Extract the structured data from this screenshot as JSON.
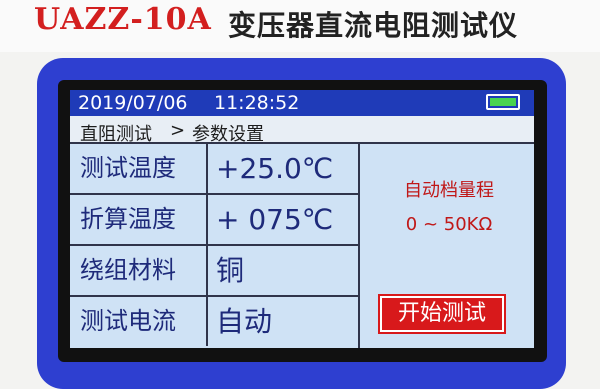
{
  "header": {
    "model": "UAZZ-10A",
    "product_name": "变压器直流电阻测试仪"
  },
  "status": {
    "date": "2019/07/06",
    "time": "11:28:52",
    "battery_icon": "battery-icon"
  },
  "breadcrumb": {
    "parent": "直阻测试",
    "separator": ">",
    "current": "参数设置"
  },
  "params": [
    {
      "label": "测试温度",
      "value": "+25.0℃"
    },
    {
      "label": "折算温度",
      "value": "+ 075℃"
    },
    {
      "label": "绕组材料",
      "value": "铜"
    },
    {
      "label": "测试电流",
      "value": "自动"
    }
  ],
  "range": {
    "title": "自动档量程",
    "value": "0 ~ 50KΩ"
  },
  "start_button": {
    "label": "开始测试"
  },
  "colors": {
    "bezel": "#2e3fd0",
    "statusbar": "#1f3bb8",
    "screen_bg": "#cfe2f5",
    "accent_red": "#d8191b",
    "text_blue": "#1e2a7a"
  }
}
